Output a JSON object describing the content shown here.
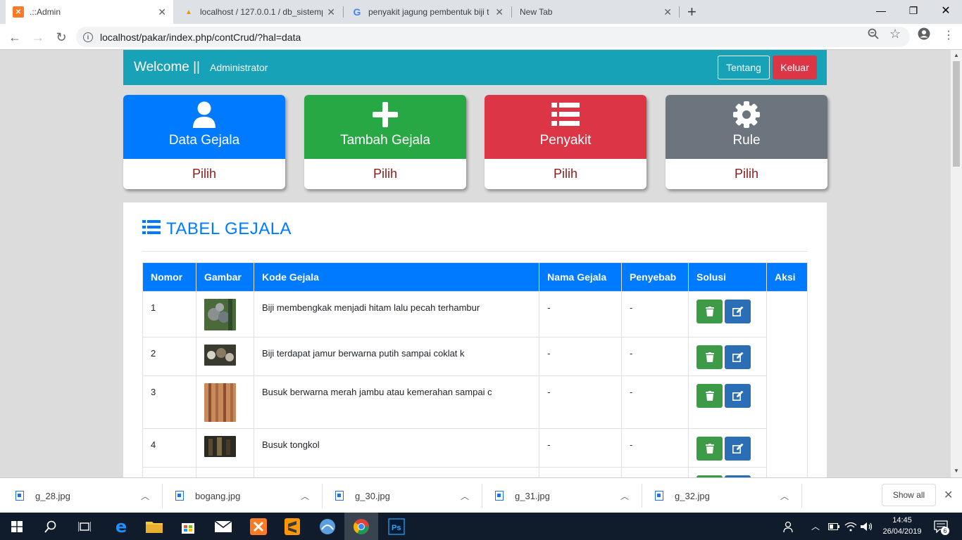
{
  "browser": {
    "tabs": [
      {
        "title": ".::Admin",
        "icon": "xampp-favicon-icon"
      },
      {
        "title": "localhost / 127.0.0.1 / db_sistemp",
        "icon": "phpmyadmin-favicon-icon"
      },
      {
        "title": "penyakit jagung pembentuk biji t",
        "icon": "google-favicon-icon"
      },
      {
        "title": "New Tab",
        "icon": ""
      }
    ],
    "url": "localhost/pakar/index.php/contCrud/?hal=data",
    "accent": "#17a2b8"
  },
  "navbar": {
    "brand": "Welcome ||",
    "user": "Administrator",
    "tentang": "Tentang",
    "keluar": "Keluar"
  },
  "cards": [
    {
      "title": "Data Gejala",
      "footer": "Pilih",
      "color": "#007bff",
      "icon": "user-icon"
    },
    {
      "title": "Tambah Gejala",
      "footer": "Pilih",
      "color": "#28a745",
      "icon": "plus-icon"
    },
    {
      "title": "Penyakit",
      "footer": "Pilih",
      "color": "#dc3545",
      "icon": "list-icon"
    },
    {
      "title": "Rule",
      "footer": "Pilih",
      "color": "#6c757d",
      "icon": "gear-icon"
    }
  ],
  "panel": {
    "title": "TABEL GEJALA"
  },
  "table": {
    "headers": [
      "Nomor",
      "Gambar",
      "Kode Gejala",
      "Nama Gejala",
      "Penyebab",
      "Solusi",
      "Aksi"
    ],
    "rows": [
      {
        "no": "1",
        "kode": "Biji membengkak menjadi hitam lalu pecah terhambur",
        "nama": "-",
        "penyebab": "-"
      },
      {
        "no": "2",
        "kode": "Biji terdapat jamur berwarna putih sampai coklat k",
        "nama": "-",
        "penyebab": "-"
      },
      {
        "no": "3",
        "kode": "Busuk berwarna merah jambu atau kemerahan sampai c",
        "nama": "-",
        "penyebab": "-"
      },
      {
        "no": "4",
        "kode": "Busuk tongkol",
        "nama": "-",
        "penyebab": "-"
      }
    ]
  },
  "downloads": {
    "items": [
      "g_28.jpg",
      "bogang.jpg",
      "g_30.jpg",
      "g_31.jpg",
      "g_32.jpg"
    ],
    "show_all": "Show all"
  },
  "taskbar": {
    "time": "14:45",
    "date": "26/04/2019",
    "notifications": "6"
  }
}
